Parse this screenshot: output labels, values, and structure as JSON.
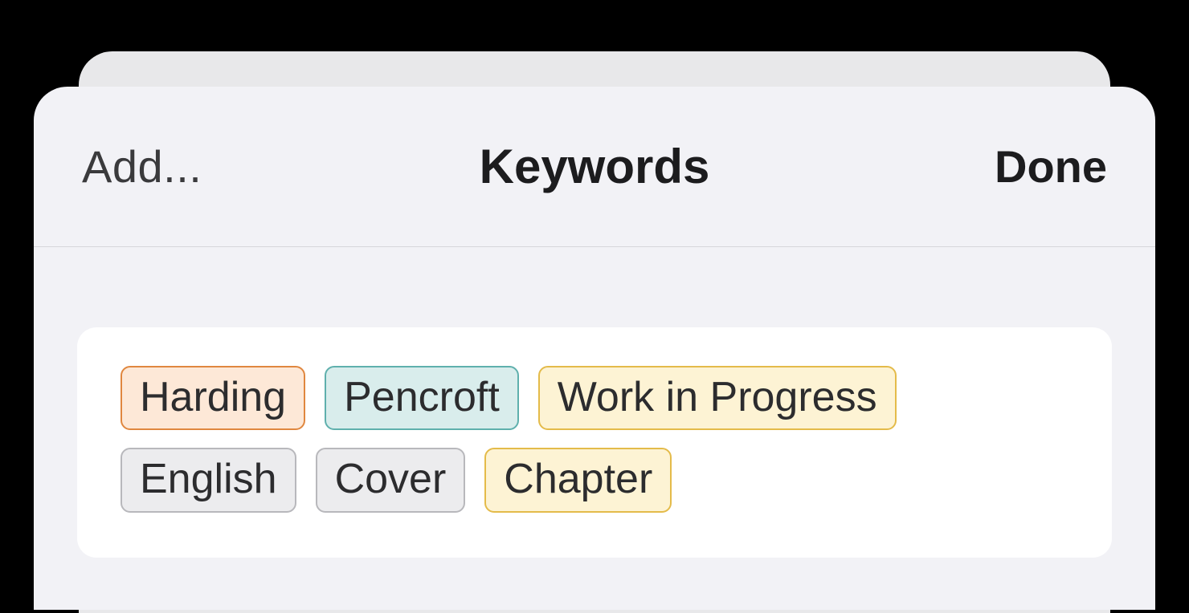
{
  "header": {
    "add_label": "Add...",
    "title": "Keywords",
    "done_label": "Done"
  },
  "keywords": [
    {
      "label": "Harding",
      "color": "orange"
    },
    {
      "label": "Pencroft",
      "color": "teal"
    },
    {
      "label": "Work in Progress",
      "color": "yellow"
    },
    {
      "label": "English",
      "color": "gray"
    },
    {
      "label": "Cover",
      "color": "gray"
    },
    {
      "label": "Chapter",
      "color": "yellow"
    }
  ]
}
